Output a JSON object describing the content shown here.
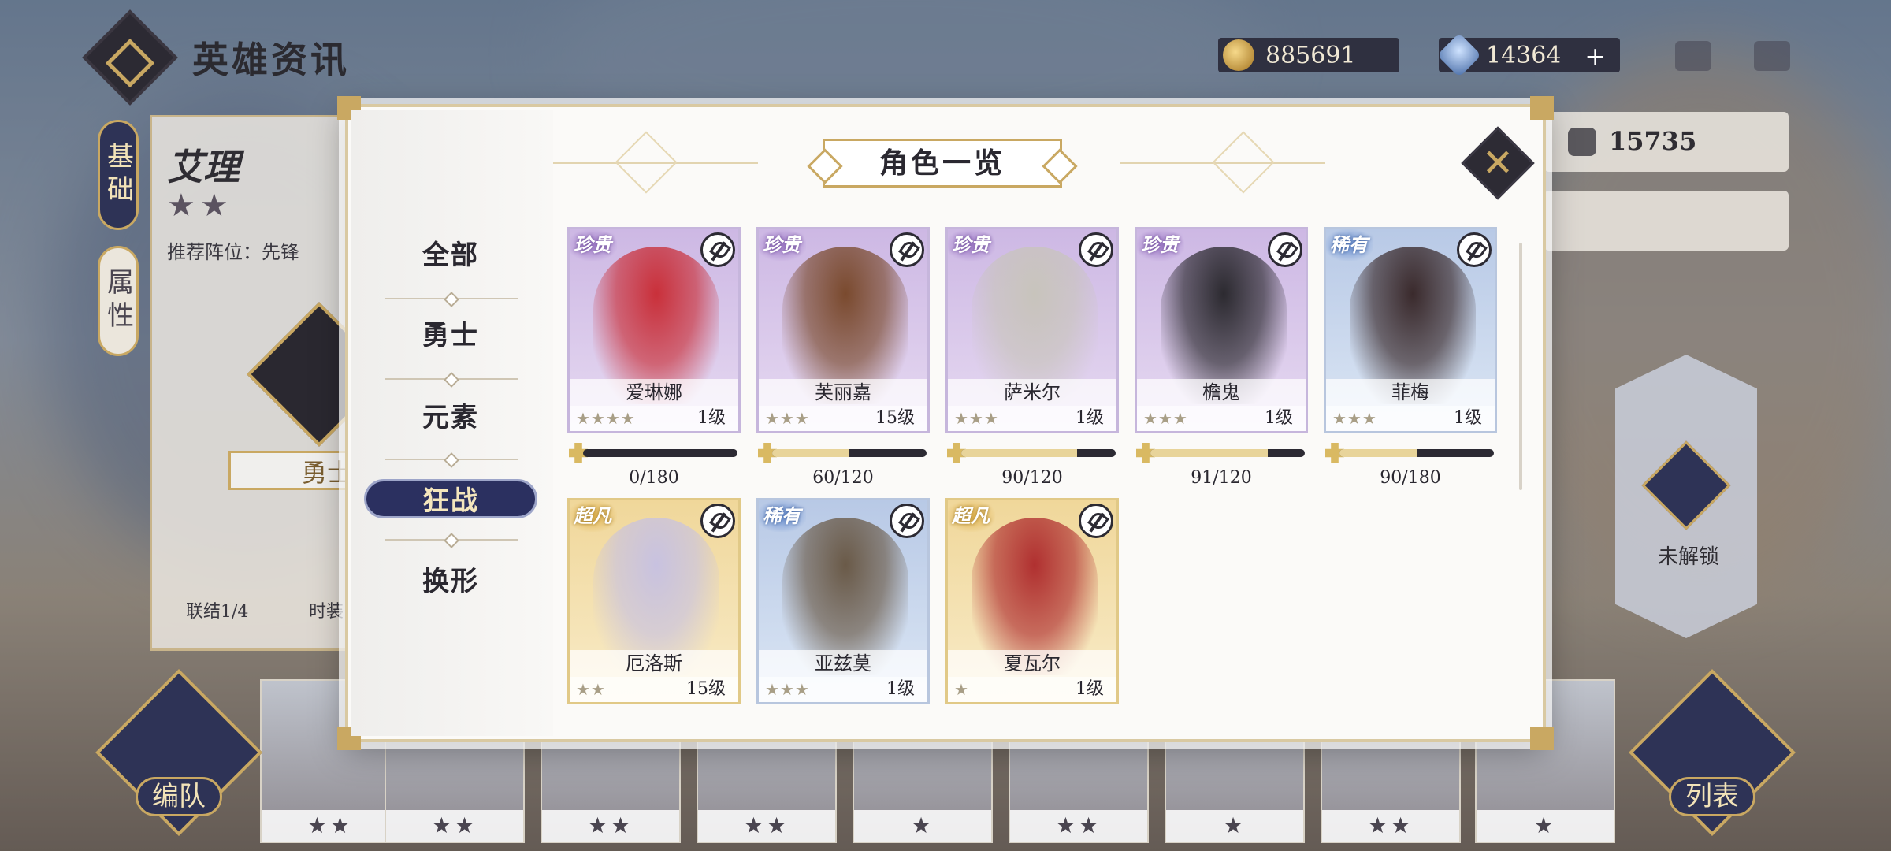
{
  "topbar": {
    "title": "英雄资讯",
    "gold": "885691",
    "gems": "14364",
    "gems_plus": "+"
  },
  "left_panel": {
    "tab_basic": "基础",
    "tab_attr": "属性",
    "hero_name": "艾理",
    "hero_stars": "★★",
    "recommended": "推荐阵位：先锋",
    "type_label": "勇士",
    "link": "联结1/4",
    "fashion": "时装"
  },
  "right_panel": {
    "power": "15735",
    "locked": "未解锁"
  },
  "modal": {
    "title": "角色一览",
    "close_glyph": "✕",
    "categories": [
      {
        "label": "全部",
        "active": false
      },
      {
        "label": "勇士",
        "active": false
      },
      {
        "label": "元素",
        "active": false
      },
      {
        "label": "狂战",
        "active": true
      },
      {
        "label": "换形",
        "active": false
      }
    ],
    "heroes": [
      {
        "name": "爱琳娜",
        "rarity": "珍贵",
        "rarity_color": "purple",
        "stars": "★★★★",
        "level": "1级",
        "progress": "0/180",
        "progress_value": 0,
        "portrait_color": "#c9303a"
      },
      {
        "name": "芙丽嘉",
        "rarity": "珍贵",
        "rarity_color": "purple",
        "stars": "★★★",
        "level": "15级",
        "progress": "60/120",
        "progress_value": 0.5,
        "portrait_color": "#7a4a2e"
      },
      {
        "name": "萨米尔",
        "rarity": "珍贵",
        "rarity_color": "purple",
        "stars": "★★★",
        "level": "1级",
        "progress": "90/120",
        "progress_value": 0.75,
        "portrait_color": "#c8c4bc"
      },
      {
        "name": "檐鬼",
        "rarity": "珍贵",
        "rarity_color": "purple",
        "stars": "★★★",
        "level": "1级",
        "progress": "91/120",
        "progress_value": 0.758,
        "portrait_color": "#2c2a30"
      },
      {
        "name": "菲梅",
        "rarity": "稀有",
        "rarity_color": "blue",
        "stars": "★★★",
        "level": "1级",
        "progress": "90/180",
        "progress_value": 0.5,
        "portrait_color": "#3a2a2c"
      },
      {
        "name": "厄洛斯",
        "rarity": "超凡",
        "rarity_color": "gold",
        "stars": "★★",
        "level": "15级",
        "progress": "",
        "progress_value": null,
        "portrait_color": "#c8c2e0"
      },
      {
        "name": "亚兹莫",
        "rarity": "稀有",
        "rarity_color": "blue",
        "stars": "★★★",
        "level": "1级",
        "progress": "",
        "progress_value": null,
        "portrait_color": "#6a5a48"
      },
      {
        "name": "夏瓦尔",
        "rarity": "超凡",
        "rarity_color": "gold",
        "stars": "★",
        "level": "1级",
        "progress": "",
        "progress_value": null,
        "portrait_color": "#b03030"
      }
    ]
  },
  "bottom": {
    "team_btn": "编队",
    "list_btn": "列表",
    "roster_stars": [
      "★★",
      "★★",
      "★★",
      "★★",
      "★",
      "★★",
      "★",
      "★★",
      "★"
    ]
  },
  "colors": {
    "accent_gold": "#c9a862",
    "navy": "#2b3060",
    "rarity_purple": "#a07cc8",
    "rarity_blue": "#6d92d2",
    "rarity_gold": "#e0b24e"
  }
}
